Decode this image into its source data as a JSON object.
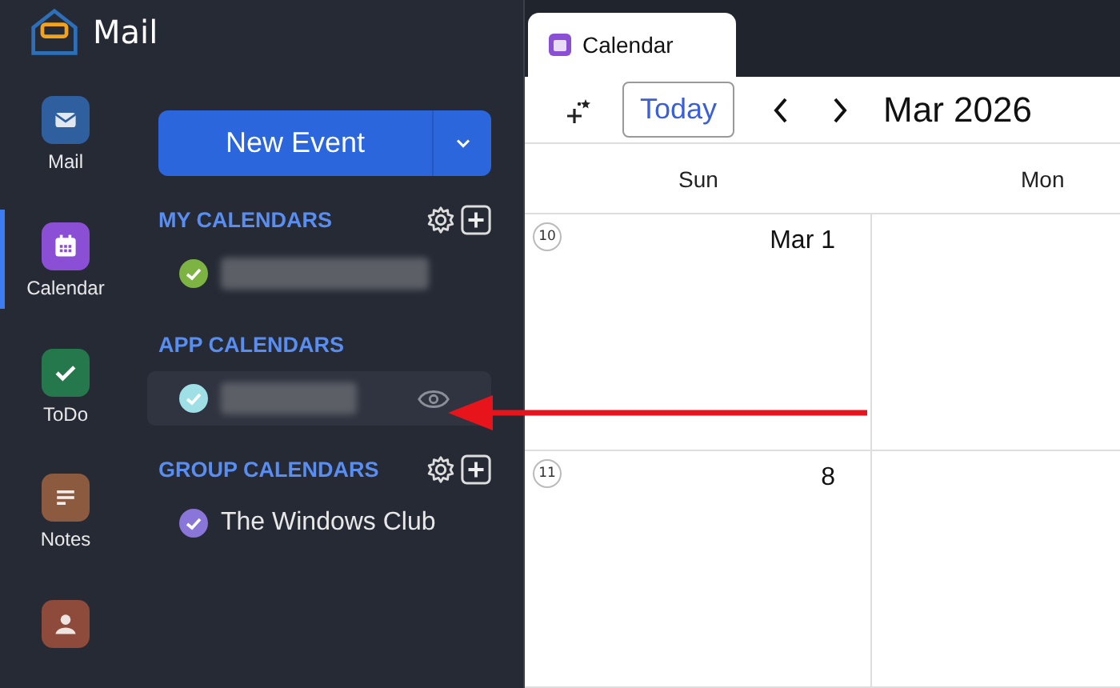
{
  "app": {
    "title": "Mail"
  },
  "rail": [
    {
      "kind": "mail",
      "label": "Mail",
      "color": "#2f5f9e",
      "selected": false
    },
    {
      "kind": "calendar",
      "label": "Calendar",
      "color": "#8b4fd6",
      "selected": true
    },
    {
      "kind": "todo",
      "label": "ToDo",
      "color": "#25784c",
      "selected": false
    },
    {
      "kind": "notes",
      "label": "Notes",
      "color": "#8c5a3e",
      "selected": false
    },
    {
      "kind": "contacts",
      "color": "#8e4a3b",
      "selected": false
    }
  ],
  "new_event_button": {
    "label": "New Event"
  },
  "sections": [
    {
      "title": "MY CALENDARS",
      "tools": true,
      "items": [
        {
          "color": "#7cb342",
          "redacted": true,
          "hovered": false
        }
      ]
    },
    {
      "title": "APP CALENDARS",
      "tools": false,
      "items": [
        {
          "color": "#9ee0e6",
          "redacted": true,
          "hovered": true
        }
      ]
    },
    {
      "title": "GROUP CALENDARS",
      "tools": true,
      "items": [
        {
          "color": "#8a75d8",
          "name": "The Windows Club",
          "redacted": false,
          "hovered": false
        }
      ]
    }
  ],
  "tab": {
    "label": "Calendar"
  },
  "toolbar": {
    "today_button": "Today",
    "period": "Mar 2026"
  },
  "week_grid": {
    "days": [
      "Sun",
      "Mon"
    ],
    "weeks": [
      {
        "number": "10",
        "cells": [
          "Mar 1",
          ""
        ]
      },
      {
        "number": "11",
        "cells": [
          "8",
          ""
        ]
      }
    ]
  },
  "annotation": {
    "kind": "arrow"
  }
}
